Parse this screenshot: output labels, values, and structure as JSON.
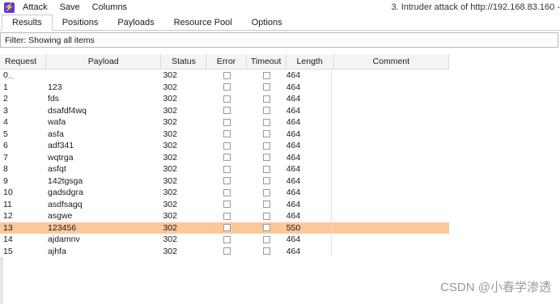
{
  "menubar": {
    "app_icon": "burp-lightning-icon",
    "items": [
      "Attack",
      "Save",
      "Columns"
    ],
    "window_title": "3. Intruder attack of http://192.168.83.160 -"
  },
  "tabs": [
    {
      "label": "Results",
      "active": true
    },
    {
      "label": "Positions",
      "active": false
    },
    {
      "label": "Payloads",
      "active": false
    },
    {
      "label": "Resource Pool",
      "active": false
    },
    {
      "label": "Options",
      "active": false
    }
  ],
  "filter": {
    "text": "Filter: Showing all items"
  },
  "table": {
    "columns": [
      "Request",
      "Payload",
      "Status",
      "Error",
      "Timeout",
      "Length",
      "Comment"
    ],
    "rows": [
      {
        "request": "0",
        "payload": "",
        "status": "302",
        "length": "464"
      },
      {
        "request": "1",
        "payload": "123",
        "status": "302",
        "length": "464"
      },
      {
        "request": "2",
        "payload": "fds",
        "status": "302",
        "length": "464"
      },
      {
        "request": "3",
        "payload": "dsafdf4wq",
        "status": "302",
        "length": "464"
      },
      {
        "request": "4",
        "payload": "wafa",
        "status": "302",
        "length": "464"
      },
      {
        "request": "5",
        "payload": "asfa",
        "status": "302",
        "length": "464"
      },
      {
        "request": "6",
        "payload": "adf341",
        "status": "302",
        "length": "464"
      },
      {
        "request": "7",
        "payload": "wqtrga",
        "status": "302",
        "length": "464"
      },
      {
        "request": "8",
        "payload": "asfqt",
        "status": "302",
        "length": "464"
      },
      {
        "request": "9",
        "payload": "142tgsga",
        "status": "302",
        "length": "464"
      },
      {
        "request": "10",
        "payload": "gadsdgra",
        "status": "302",
        "length": "464"
      },
      {
        "request": "11",
        "payload": "asdfsagq",
        "status": "302",
        "length": "464"
      },
      {
        "request": "12",
        "payload": "asgwe",
        "status": "302",
        "length": "464"
      },
      {
        "request": "13",
        "payload": "123456",
        "status": "302",
        "length": "550"
      },
      {
        "request": "14",
        "payload": "ajdamnv",
        "status": "302",
        "length": "464"
      },
      {
        "request": "15",
        "payload": "ajhfa",
        "status": "302",
        "length": "464"
      }
    ],
    "highlight_color": "#fcc89a"
  },
  "watermark": "CSDN @小春学渗透"
}
